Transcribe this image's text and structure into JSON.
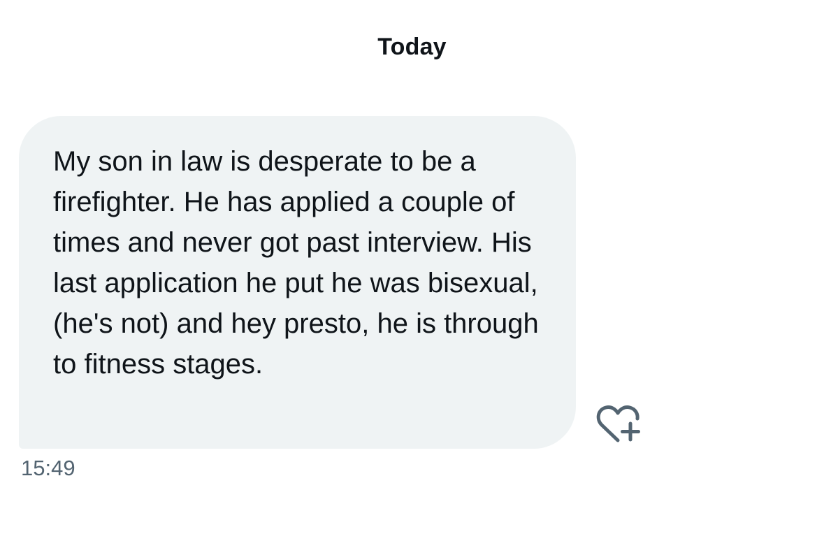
{
  "conversation": {
    "date_header": "Today"
  },
  "message": {
    "text": "My son in law is desperate to be a firefighter. He has applied a couple of times and never got past interview. His last application he put he was bisexual, (he's not) and hey presto, he is through to fitness stages.",
    "timestamp": "15:49",
    "bubble_color": "#eff3f4",
    "text_color": "#0f1419",
    "timestamp_color": "#536471",
    "reaction_icon": "heart-plus-icon"
  }
}
